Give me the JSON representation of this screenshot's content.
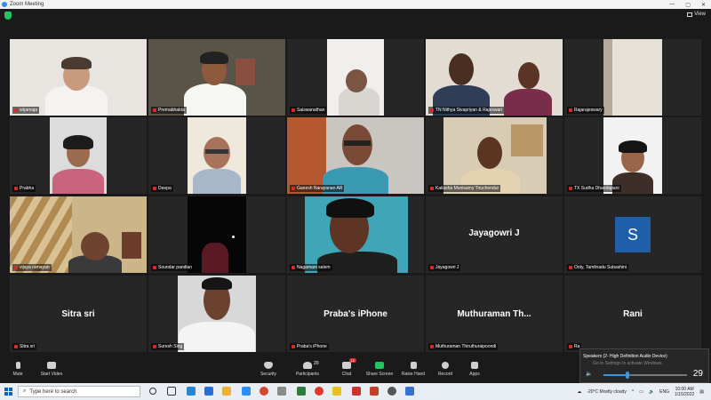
{
  "window": {
    "title": "Zoom Meeting",
    "controls": [
      "—",
      "▢",
      "✕"
    ]
  },
  "topbar": {
    "view_label": "View"
  },
  "participants": [
    {
      "name": "srijamaja",
      "muted": true,
      "video": true
    },
    {
      "name": "Premabhakta",
      "muted": true,
      "video": true,
      "active": true
    },
    {
      "name": "Saiswanathan",
      "muted": true,
      "video": true
    },
    {
      "name": "TN Nithya Sivapriyan & Rajeswari",
      "muted": true,
      "video": true
    },
    {
      "name": "Rajarajeswary",
      "muted": true,
      "video": true
    },
    {
      "name": "Prabha",
      "muted": true,
      "video": true
    },
    {
      "name": "Deepa",
      "muted": true,
      "video": true
    },
    {
      "name": "Ganesh Narayanan AR",
      "muted": true,
      "video": true
    },
    {
      "name": "Kailasha Munisamy Tiruchendur",
      "muted": true,
      "video": true
    },
    {
      "name": "TX Sudha Dhandapani",
      "muted": true,
      "video": true
    },
    {
      "name": "vijaya ramayan",
      "muted": true,
      "video": true
    },
    {
      "name": "Soundar pandian",
      "muted": true,
      "video": true
    },
    {
      "name": "Nagamani salem",
      "muted": true,
      "video": true
    },
    {
      "name": "Jayagowri J",
      "muted": true,
      "video": false,
      "display": "Jayagowri J"
    },
    {
      "name": "Ooty, Tamilnadu Subashini",
      "muted": true,
      "video": false,
      "avatar_letter": "S"
    },
    {
      "name": "Sitra sri",
      "muted": true,
      "video": false,
      "display": "Sitra sri"
    },
    {
      "name": "Suresh Sing",
      "muted": true,
      "video": true
    },
    {
      "name": "Praba's iPhone",
      "muted": true,
      "video": false,
      "display": "Praba's iPhone"
    },
    {
      "name": "Muthuraman Thiruthuraipoondi",
      "muted": true,
      "video": false,
      "display": "Muthuraman  Th..."
    },
    {
      "name": "Ra",
      "muted": true,
      "video": false,
      "display": "Rani"
    }
  ],
  "toolbar": {
    "mute": "Mute",
    "start_video": "Start Video",
    "security": "Security",
    "participants": "Participants",
    "participants_count": "20",
    "chat": "Chat",
    "chat_badge": "10",
    "share_screen": "Share Screen",
    "raise_hand": "Raise Hand",
    "record": "Record",
    "apps": "Apps"
  },
  "volume_popup": {
    "device": "Speakers (2- High Definition Audio Device)",
    "activate_text": "Go to Settings to activate Windows.",
    "level": "29",
    "level_fraction": 0.29
  },
  "taskbar": {
    "search_placeholder": "Type here to search",
    "weather": "-20°C  Mostly cloudy",
    "language": "ENG",
    "time": "10:00 AM",
    "date": "1/15/2022"
  },
  "colors": {
    "active_speaker": "#c7d33b",
    "accent": "#2d8cff",
    "mute": "#e02828",
    "share": "#23c55e"
  }
}
